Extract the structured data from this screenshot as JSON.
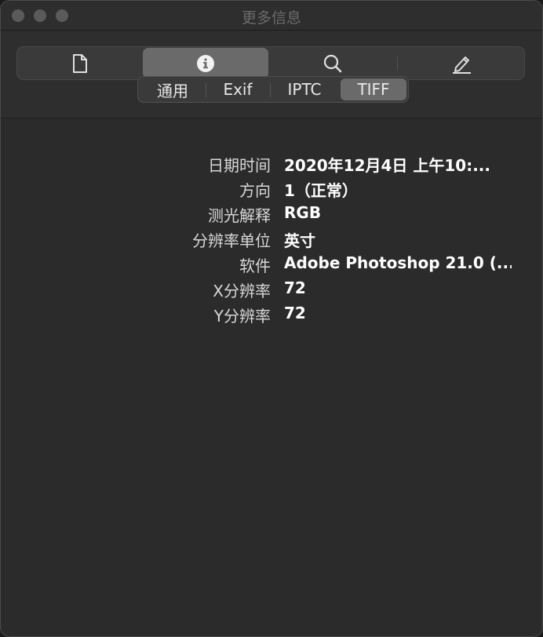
{
  "window": {
    "title": "更多信息"
  },
  "toolbar": {
    "items": [
      {
        "icon": "document-icon"
      },
      {
        "icon": "info-icon",
        "selected": true
      },
      {
        "icon": "search-icon"
      },
      {
        "icon": "pencil-icon"
      }
    ]
  },
  "tabs": [
    "通用",
    "Exif",
    "IPTC",
    "TIFF"
  ],
  "selected_tab": "TIFF",
  "rows": [
    {
      "label": "日期时间",
      "value": "2020年12月4日 上午10:..."
    },
    {
      "label": "方向",
      "value": "1（正常）"
    },
    {
      "label": "测光解释",
      "value": "RGB"
    },
    {
      "label": "分辨率单位",
      "value": "英寸"
    },
    {
      "label": "软件",
      "value": "Adobe Photoshop 21.0 (..."
    },
    {
      "label": "X分辨率",
      "value": "72"
    },
    {
      "label": "Y分辨率",
      "value": "72"
    }
  ]
}
